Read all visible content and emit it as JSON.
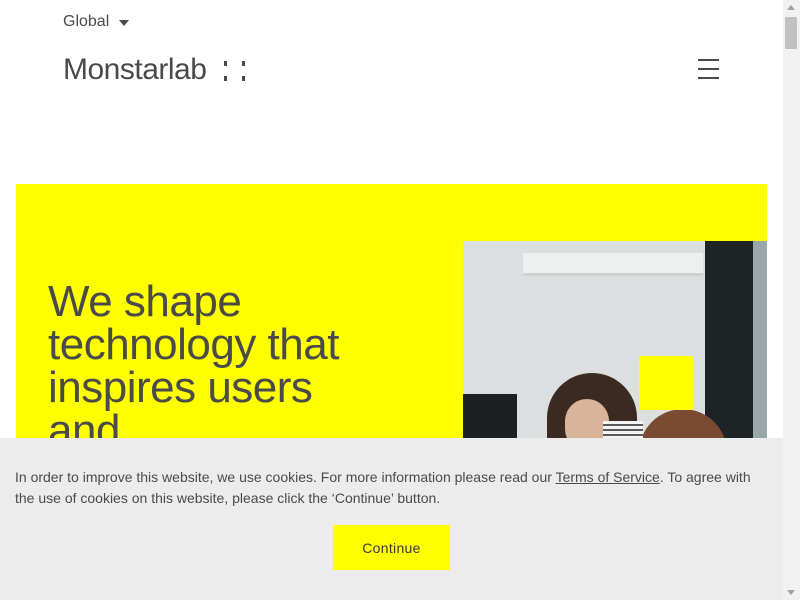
{
  "header": {
    "region_label": "Global",
    "logo_text": "Monstarlab"
  },
  "hero": {
    "title": "We shape technology that inspires users and"
  },
  "cookie_banner": {
    "text_before_link": "In order to improve this website, we use cookies. For more information please read our ",
    "link_text": "Terms of Service",
    "text_after_link": ". To agree with the use of cookies on this website, please click the ‘Continue’ button.",
    "button_label": "Continue"
  },
  "icons": {
    "region": "chevron-down-icon",
    "menu": "hamburger-menu-icon"
  },
  "colors": {
    "accent": "#ffff00",
    "text": "#4a4a4a",
    "banner_bg": "#ececec"
  }
}
